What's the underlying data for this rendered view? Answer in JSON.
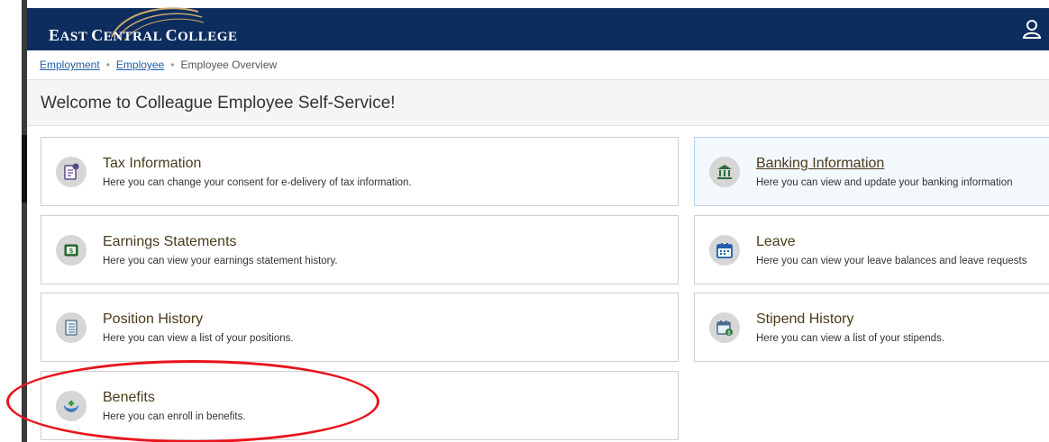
{
  "header": {
    "logo_text_first": "E",
    "logo_text_rest_1": "AST ",
    "logo_text_c": "C",
    "logo_text_rest_2": "ENTRAL ",
    "logo_text_c2": "C",
    "logo_text_rest_3": "OLLEGE",
    "bg_color": "#0d2d5e"
  },
  "breadcrumb": {
    "items": [
      "Employment",
      "Employee"
    ],
    "separator": "•",
    "current": "Employee Overview"
  },
  "page": {
    "title": "Welcome to Colleague Employee Self-Service!"
  },
  "cards": {
    "tax": {
      "title": "Tax Information",
      "desc": "Here you can change your consent for e-delivery of tax information.",
      "icon": "tax-document-icon"
    },
    "earnings": {
      "title": "Earnings Statements",
      "desc": "Here you can view your earnings statement history.",
      "icon": "dollar-bill-icon"
    },
    "position": {
      "title": "Position History",
      "desc": "Here you can view a list of your positions.",
      "icon": "list-document-icon"
    },
    "benefits": {
      "title": "Benefits",
      "desc": "Here you can enroll in benefits.",
      "icon": "hands-heart-icon"
    },
    "banking": {
      "title": "Banking Information",
      "desc": "Here you can view and update your banking information",
      "icon": "bank-icon"
    },
    "leave": {
      "title": "Leave",
      "desc": "Here you can view your leave balances and leave requests",
      "icon": "calendar-icon"
    },
    "stipend": {
      "title": "Stipend History",
      "desc": "Here you can view a list of your stipends.",
      "icon": "calendar-dollar-icon"
    }
  },
  "colors": {
    "annotation": "#e8141b",
    "link": "#1f5fa8"
  }
}
